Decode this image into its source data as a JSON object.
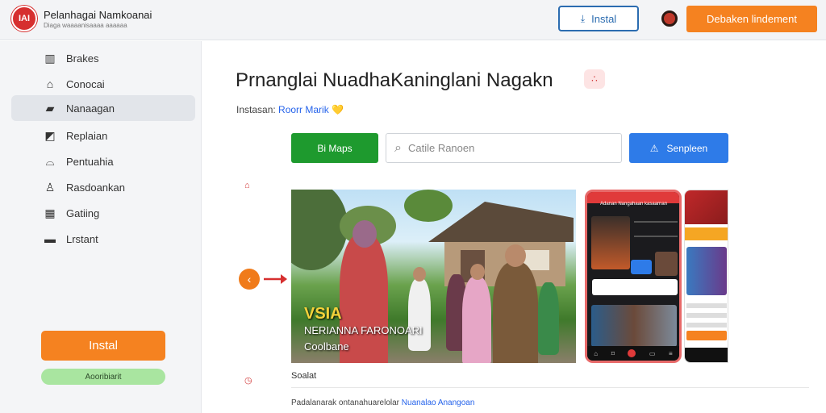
{
  "header": {
    "logo_text": "IAI",
    "app_title": "Pelanhagai Namkoanai",
    "app_subtitle": "Diaga waaaanisaaaa aaaaaa",
    "install_label": "Instal",
    "cta_label": "Debaken lindement"
  },
  "sidebar": {
    "items": [
      {
        "label": "Brakes",
        "icon": "building-icon"
      },
      {
        "label": "Conocai",
        "icon": "home-icon"
      },
      {
        "label": "Nanaagan",
        "icon": "folder-icon"
      },
      {
        "label": "Replaian",
        "icon": "image-icon"
      },
      {
        "label": "Pentuahia",
        "icon": "bell-icon"
      },
      {
        "label": "Rasdoankan",
        "icon": "user-lock-icon"
      },
      {
        "label": "Gatiing",
        "icon": "grid-icon"
      },
      {
        "label": "Lrstant",
        "icon": "box-icon"
      }
    ],
    "active_index": 2,
    "install_label": "Instal",
    "badge_label": "Aooribiarit"
  },
  "main": {
    "title": "Prnanglai NuadhaKaninglani Nagakn",
    "meta_prefix": "Instasan:",
    "meta_link": "Roorr Marik",
    "meta_heart": "💛",
    "green_button": "Bi Maps",
    "search_placeholder": "Catile Ranoen",
    "blue_button": "Senpleen",
    "hero_caption_1": "VSIA",
    "hero_caption_2": "NERIANNA FARONOARI",
    "hero_caption_3": "Coolbane",
    "phone_title": "Adanan Nangahaan kasaarnan",
    "section_label": "Soalat",
    "description_text": "Padalanarak ontanahuarelolar",
    "description_link": "Nuanalao Anangoan"
  },
  "colors": {
    "accent_orange": "#f58220",
    "green": "#1e9a2e",
    "blue": "#2e7be8",
    "brand_red": "#d62f2f"
  }
}
